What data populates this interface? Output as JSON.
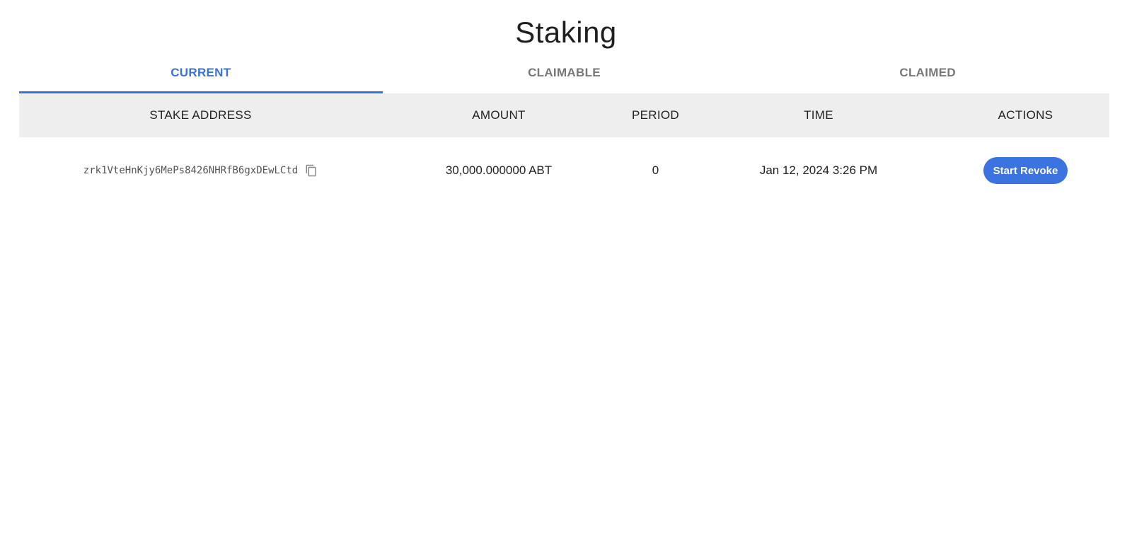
{
  "page": {
    "title": "Staking"
  },
  "tabs": [
    {
      "label": "CURRENT",
      "active": true
    },
    {
      "label": "CLAIMABLE",
      "active": false
    },
    {
      "label": "CLAIMED",
      "active": false
    }
  ],
  "table": {
    "headers": {
      "address": "STAKE ADDRESS",
      "amount": "AMOUNT",
      "period": "PERIOD",
      "time": "TIME",
      "actions": "ACTIONS"
    },
    "rows": [
      {
        "address": "zrk1VteHnKjy6MePs8426NHRfB6gxDEwLCtd",
        "amount": "30,000.000000 ABT",
        "period": "0",
        "time": "Jan 12, 2024 3:26 PM",
        "action_label": "Start Revoke"
      }
    ]
  },
  "icons": {
    "copy": "copy-icon"
  },
  "colors": {
    "accent": "#3a72d8",
    "button": "#3b73e0",
    "header_bg": "#eeeeee",
    "inactive_tab": "#777777"
  }
}
